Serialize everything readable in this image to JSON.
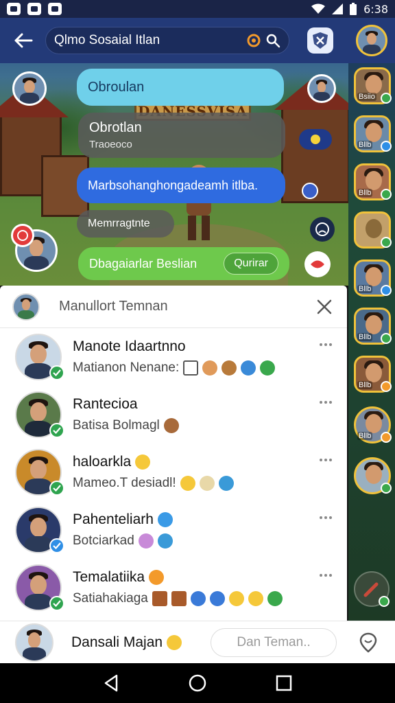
{
  "status_bar": {
    "time": "6:38"
  },
  "app_bar": {
    "search_text": "Qlmo Sosaial Itlan"
  },
  "chat": {
    "bubble1": "Obroulan",
    "bubble2_line1": "Obrotlan",
    "bubble2_line2": "Traoeoco",
    "bubble3": "Marbsohanghongadeamh itlba.",
    "bubble4": "Memrragtnte",
    "bubble5": "Dbagaiarlar Beslian",
    "bubble5_button": "Qurirar"
  },
  "right_strip": {
    "labels": [
      "Bsiio",
      "Bllb",
      "Bllb",
      "",
      "Bllb",
      "Bllb",
      "Bllb",
      "Bllb",
      ""
    ]
  },
  "panel": {
    "title": "Manullort Temnan",
    "friends": [
      {
        "name": "Manote Idaartnno",
        "sub": "Matianon Nenane:"
      },
      {
        "name": "Rantecioa",
        "sub": "Batisa Bolmagl"
      },
      {
        "name": "haloarkla",
        "sub": "Mameo.T desiadl!"
      },
      {
        "name": "Pahenteliarh",
        "sub": "Botciarkad"
      },
      {
        "name": "Temalatiika",
        "sub": "Satiahakiaga"
      }
    ]
  },
  "bottom": {
    "name": "Dansali Majan",
    "search_placeholder": "Dan Teman.."
  },
  "colors": {
    "appbar": "#233a78",
    "bubble_cyan": "#6fd0ea",
    "bubble_blue": "#2f6be0",
    "bubble_green": "#6ec94c",
    "online_green": "#2fa44f"
  }
}
